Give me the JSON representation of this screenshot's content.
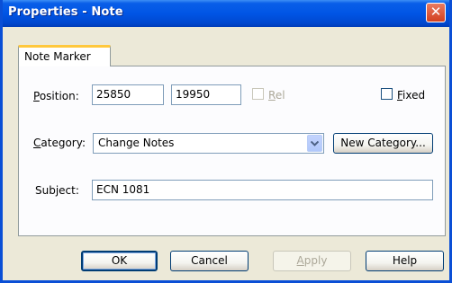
{
  "window": {
    "title": "Properties - Note",
    "close_symbol": "✕"
  },
  "tabs": [
    {
      "label": "Note Marker",
      "selected": true
    }
  ],
  "position": {
    "label": "Position:",
    "x_value": "25850",
    "y_value": "19950"
  },
  "rel": {
    "label": "Rel",
    "checked": false,
    "enabled": false
  },
  "fixed": {
    "label": "Fixed",
    "checked": false
  },
  "category": {
    "label": "Category:",
    "selected": "Change Notes",
    "new_button_label": "New Category..."
  },
  "subject": {
    "label": "Subject:",
    "value": "ECN 1081"
  },
  "buttons": {
    "ok": "OK",
    "cancel": "Cancel",
    "apply": "Apply",
    "help": "Help"
  },
  "colors": {
    "titlebar": "#0055e5",
    "window_bg": "#ece9d8",
    "tab_highlight": "#ffc83c"
  }
}
